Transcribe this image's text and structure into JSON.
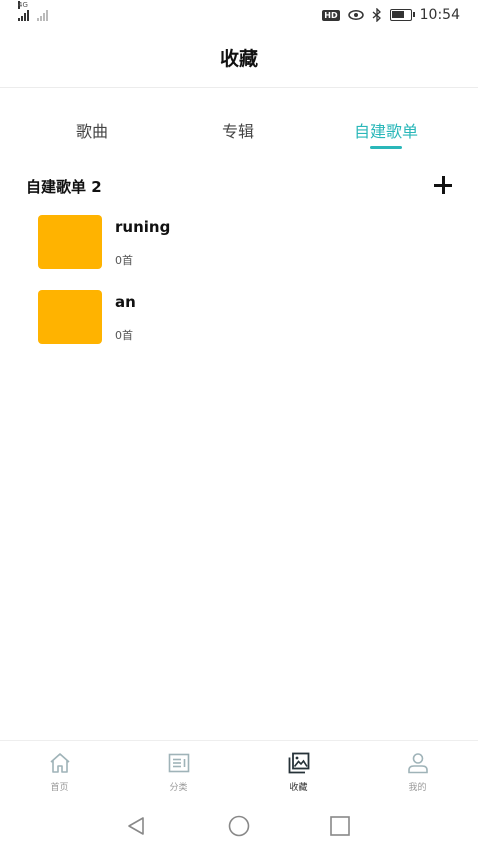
{
  "status_bar": {
    "network_label": "4G",
    "time": "10:54",
    "hd_badge": "HD",
    "battery_level": 0.7
  },
  "header": {
    "title": "收藏"
  },
  "tabs": [
    {
      "label": "歌曲",
      "active": false
    },
    {
      "label": "专辑",
      "active": false
    },
    {
      "label": "自建歌单",
      "active": true
    }
  ],
  "section": {
    "title": "自建歌单 2"
  },
  "playlists": [
    {
      "name": "runing",
      "count": "0首",
      "cover_color": "#FFB300"
    },
    {
      "name": "an",
      "count": "0首",
      "cover_color": "#FFB300"
    }
  ],
  "bottom_nav": [
    {
      "label": "首页",
      "icon": "home-icon",
      "active": false
    },
    {
      "label": "分类",
      "icon": "category-icon",
      "active": false
    },
    {
      "label": "收藏",
      "icon": "collection-icon",
      "active": true
    },
    {
      "label": "我的",
      "icon": "user-icon",
      "active": false
    }
  ],
  "colors": {
    "accent": "#2ab7b9",
    "cover": "#FFB300",
    "inactive_nav": "#9fb3b8",
    "active_nav": "#263238"
  }
}
